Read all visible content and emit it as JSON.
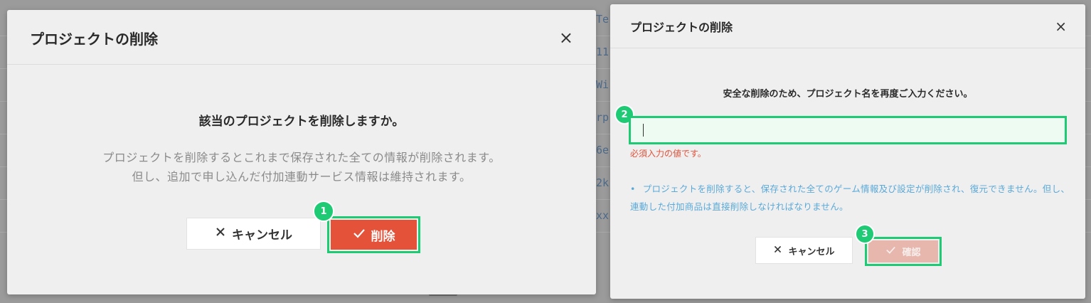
{
  "background": {
    "fragments": [
      "Te",
      "11",
      "Wi",
      "rp",
      "6e",
      "2k",
      "xx"
    ]
  },
  "delete_dialog": {
    "title": "プロジェクトの削除",
    "close": "×",
    "question": "該当のプロジェクトを削除しますか。",
    "description_line1": "プロジェクトを削除するとこれまで保存された全ての情報が削除されます。",
    "description_line2": "但し、追加で申し込んだ付加連動サービス情報は維持されます。",
    "cancel_label": "キャンセル",
    "delete_label": "削除",
    "step_badge": "1"
  },
  "confirm_dialog": {
    "title": "プロジェクトの削除",
    "close": "×",
    "message": "安全な削除のため、プロジェクト名を再度ご入力ください。",
    "input_value": "",
    "input_placeholder": "",
    "error": "必須入力の値です。",
    "note": "プロジェクトを削除すると、保存された全てのゲーム情報及び設定が削除され、復元できません。但し、連動した付加商品は直接削除しなければなりません。",
    "cancel_label": "キャンセル",
    "confirm_label": "確認",
    "step_badge_input": "2",
    "step_badge_confirm": "3"
  },
  "colors": {
    "accent_green": "#1fca75",
    "danger_red": "#e4523a",
    "disabled_red": "#e7b6ad",
    "info_blue": "#5aa9d9"
  },
  "icons": {
    "close": "close-icon",
    "cancel": "x-icon",
    "check": "check-icon"
  }
}
